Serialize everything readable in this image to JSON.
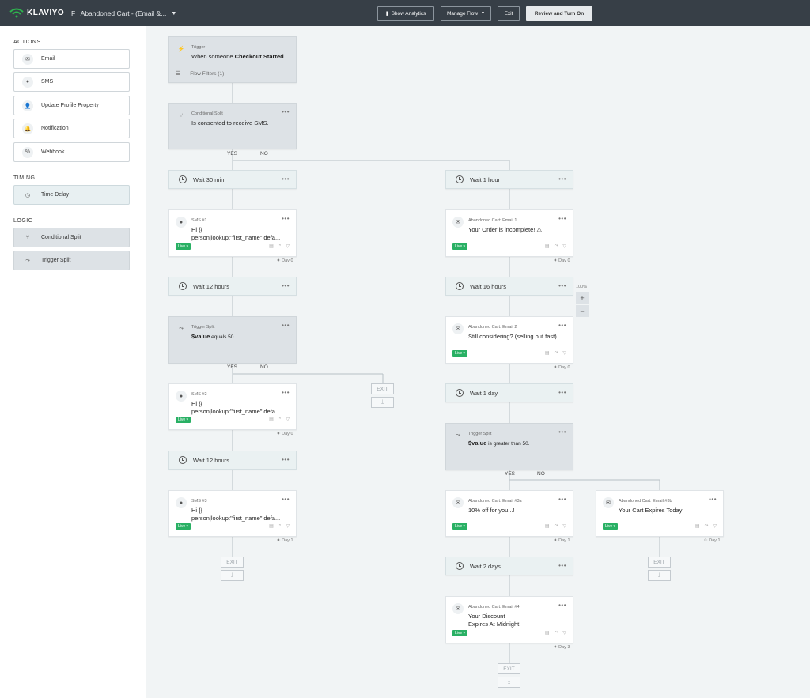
{
  "brand": {
    "logo_text": "KLAVIYO"
  },
  "header": {
    "flow_title": "F | Abandoned Cart - (Email &...",
    "show_analytics": "Show Analytics",
    "manage_flow": "Manage Flow",
    "exit": "Exit",
    "review": "Review and Turn On"
  },
  "sidebar": {
    "actions_heading": "ACTIONS",
    "actions": [
      {
        "label": "Email",
        "icon": "mail-icon"
      },
      {
        "label": "SMS",
        "icon": "chat-icon"
      },
      {
        "label": "Update Profile Property",
        "icon": "user-icon"
      },
      {
        "label": "Notification",
        "icon": "bell-icon"
      },
      {
        "label": "Webhook",
        "icon": "webhook-icon"
      }
    ],
    "timing_heading": "TIMING",
    "timing": [
      {
        "label": "Time Delay",
        "icon": "clock-icon"
      }
    ],
    "logic_heading": "LOGIC",
    "logic": [
      {
        "label": "Conditional Split",
        "icon": "split-icon"
      },
      {
        "label": "Trigger Split",
        "icon": "trigger-split-icon"
      }
    ]
  },
  "flow": {
    "trigger": {
      "label": "Trigger",
      "text_pre": "When someone ",
      "text_bold": "Checkout Started",
      "text_post": ".",
      "filters": "Flow Filters (1)"
    },
    "cond_split": {
      "label": "Conditional Split",
      "text": "Is consented to receive SMS."
    },
    "yes": "YES",
    "no": "NO",
    "exit": "EXIT",
    "live": "Live ▾",
    "dots": "•••",
    "left": {
      "wait1": "Wait 30 min",
      "sms1": {
        "label": "SMS #1",
        "line1": "Hi {{",
        "line2": "person|lookup:\"first_name\"|defa...",
        "day": "Day 0"
      },
      "wait2": "Wait 12 hours",
      "trigger_split": {
        "label": "Trigger Split",
        "text_bold": "$value",
        "text_rest": " equals 50."
      },
      "sms2": {
        "label": "SMS #2",
        "line1": "Hi {{",
        "line2": "person|lookup:\"first_name\"|defa...",
        "day": "Day 0"
      },
      "wait3": "Wait 12 hours",
      "sms3": {
        "label": "SMS #3",
        "line1": "Hi {{",
        "line2": "person|lookup:\"first_name\"|defa...",
        "day": "Day 1"
      }
    },
    "right": {
      "wait1": "Wait 1 hour",
      "email1": {
        "label": "Abandoned Cart: Email 1",
        "text": "Your Order is incomplete! ⚠",
        "day": "Day 0"
      },
      "wait2": "Wait 16 hours",
      "email2": {
        "label": "Abandoned Cart: Email 2",
        "text": "Still considering? (selling out fast)",
        "day": "Day 0"
      },
      "wait3": "Wait 1 day",
      "trigger_split": {
        "label": "Trigger Split",
        "text_bold": "$value",
        "text_rest": " is greater than 50."
      },
      "email3a": {
        "label": "Abandoned Cart: Email #3a",
        "text": "10% off for you...!",
        "day": "Day 1"
      },
      "email3b": {
        "label": "Abandoned Cart: Email #3b",
        "text": "Your Cart Expires Today",
        "day": "Day 1"
      },
      "wait4": "Wait 2 days",
      "email4": {
        "label": "Abandoned Cart: Email #4",
        "text": "Your Discount Expires At Midnight!",
        "day": "Day 3"
      }
    },
    "zoom": {
      "level": "100%",
      "plus": "+",
      "minus": "−"
    }
  }
}
